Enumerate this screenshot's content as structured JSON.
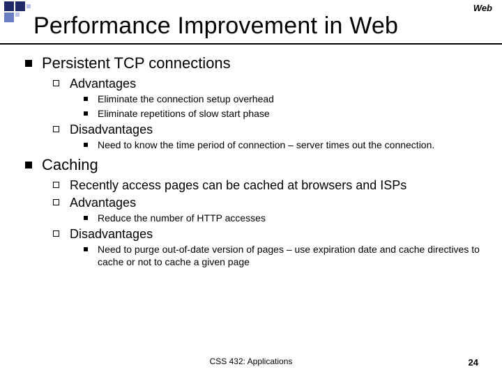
{
  "header_label": "Web",
  "title": "Performance Improvement in Web",
  "bullets": [
    {
      "text": "Persistent TCP connections",
      "children": [
        {
          "text": "Advantages",
          "children": [
            {
              "text": "Eliminate the connection setup overhead"
            },
            {
              "text": "Eliminate repetitions of slow start phase"
            }
          ]
        },
        {
          "text": "Disadvantages",
          "children": [
            {
              "text": "Need to know the time period of connection – server times out the connection."
            }
          ]
        }
      ]
    },
    {
      "text": "Caching",
      "children": [
        {
          "text": "Recently access pages can be cached at browsers and ISPs"
        },
        {
          "text": "Advantages",
          "children": [
            {
              "text": "Reduce the number of HTTP accesses"
            }
          ]
        },
        {
          "text": "Disadvantages",
          "children": [
            {
              "text": "Need to purge out-of-date version of pages – use expiration date and cache directives to cache or not to cache a given page"
            }
          ]
        }
      ]
    }
  ],
  "footer": {
    "center": "CSS 432: Applications",
    "page": "24"
  }
}
